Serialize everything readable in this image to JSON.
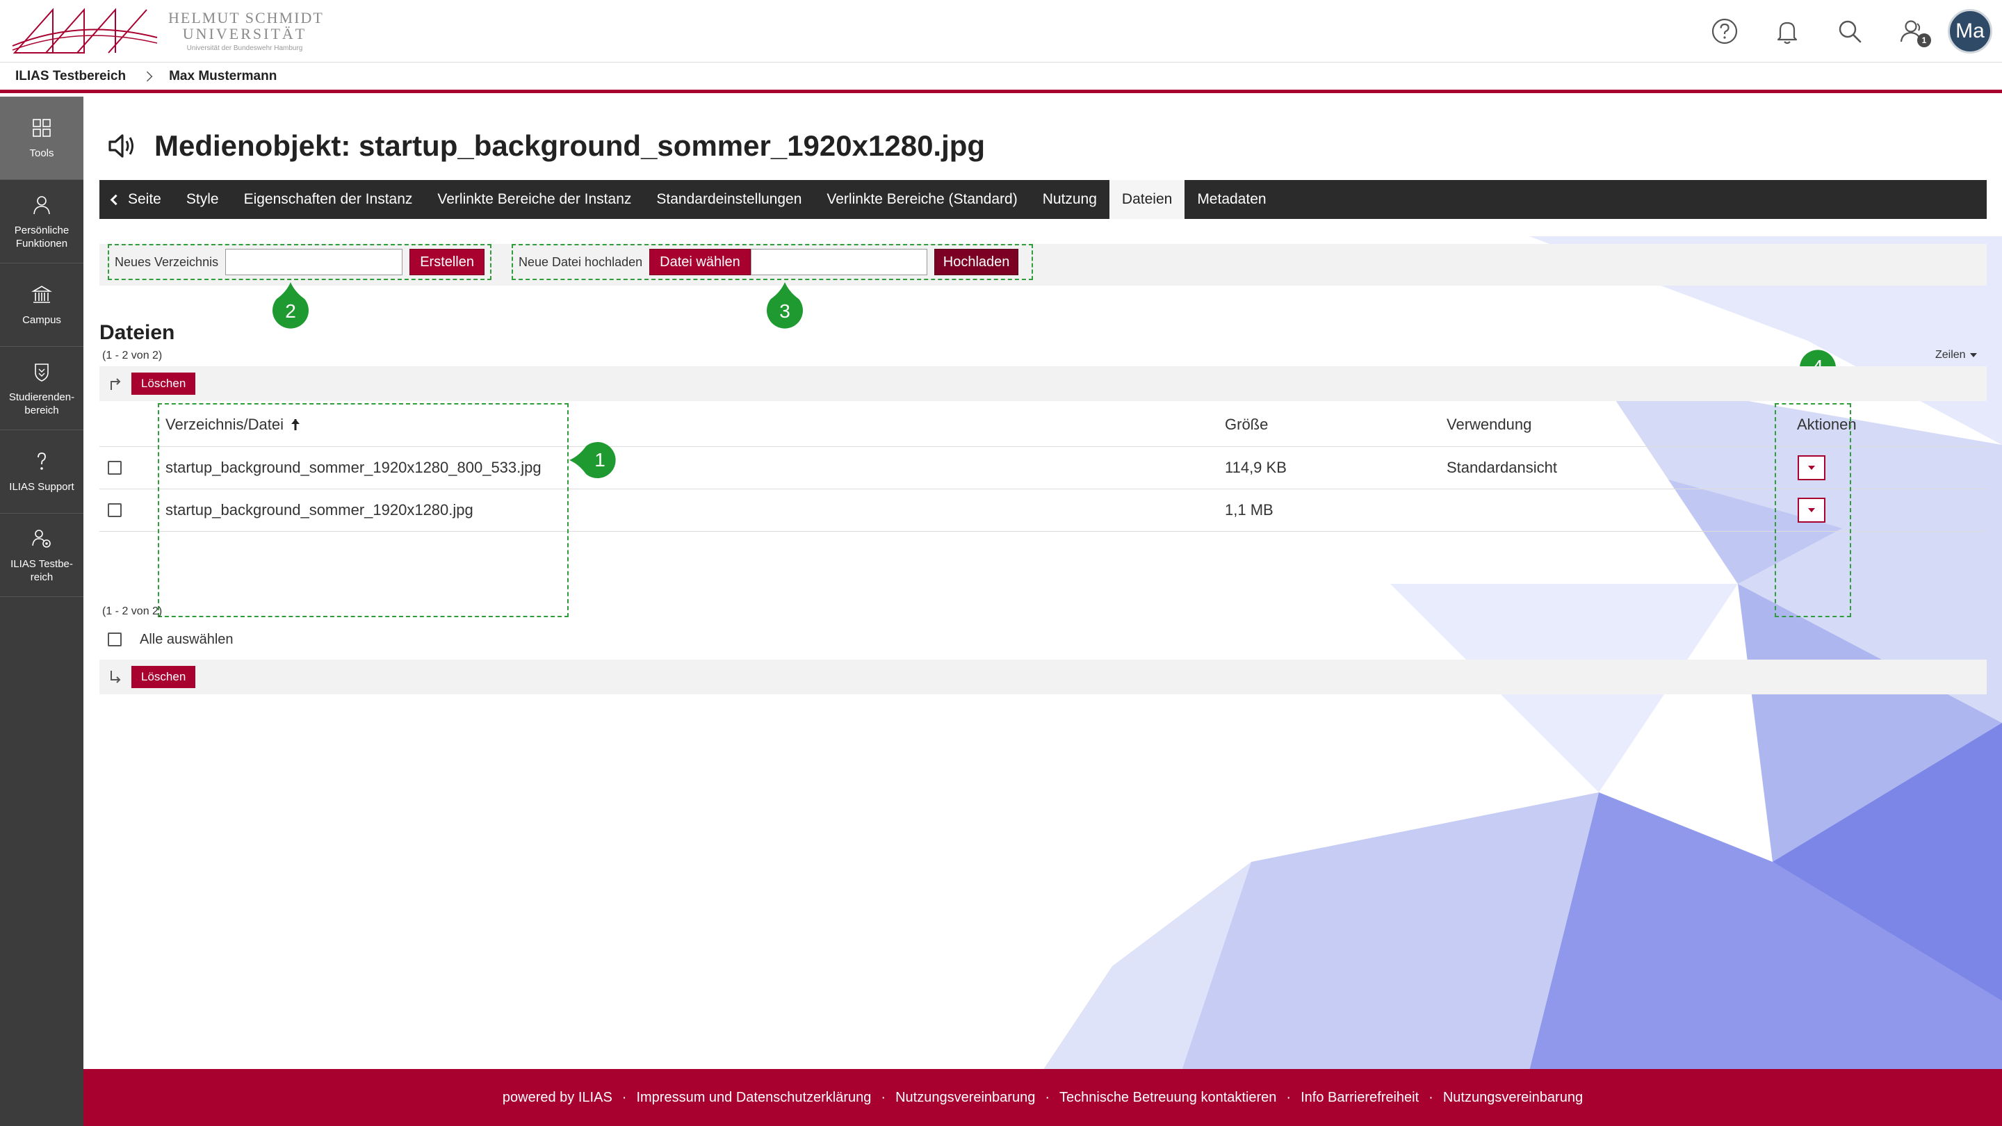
{
  "header": {
    "logo": {
      "line1": "HELMUT SCHMIDT",
      "line2": "UNIVERSITÄT",
      "line3": "Universität der Bundeswehr Hamburg"
    },
    "meta_icons": [
      "help-icon",
      "notification-icon",
      "search-icon",
      "user-notification-icon"
    ],
    "user_badge_count": "1",
    "avatar_initials": "Ma"
  },
  "breadcrumb": [
    "ILIAS Testbereich",
    "Max Mustermann"
  ],
  "mainbar": [
    {
      "label": "Tools",
      "icon": "tools-icon",
      "active": true
    },
    {
      "label": "Persönliche Funktionen",
      "icon": "user-icon"
    },
    {
      "label": "Campus",
      "icon": "campus-icon"
    },
    {
      "label": "Studierenden-bereich",
      "icon": "shield-icon"
    },
    {
      "label": "ILIAS Support",
      "icon": "question-icon"
    },
    {
      "label": "ILIAS Testbe-reich",
      "icon": "repository-icon"
    }
  ],
  "page": {
    "title": "Medienobjekt: startup_background_sommer_1920x1280.jpg",
    "title_icon": "speaker-icon"
  },
  "tabs": [
    {
      "label": "Seite",
      "back": true
    },
    {
      "label": "Style"
    },
    {
      "label": "Eigenschaften der Instanz"
    },
    {
      "label": "Verlinkte Bereiche der Instanz"
    },
    {
      "label": "Standardeinstellungen"
    },
    {
      "label": "Verlinkte Bereiche (Standard)"
    },
    {
      "label": "Nutzung"
    },
    {
      "label": "Dateien",
      "active": true
    },
    {
      "label": "Metadaten"
    }
  ],
  "toolbar": {
    "new_dir_label": "Neues Verzeichnis",
    "new_dir_value": "",
    "create_button": "Erstellen",
    "upload_label": "Neue Datei hochladen",
    "choose_file_button": "Datei wählen",
    "upload_button": "Hochladen"
  },
  "files": {
    "title": "Dateien",
    "count_top": "(1 - 2 von 2)",
    "count_bottom": "(1 - 2 von 2)",
    "rows_label": "Zeilen",
    "delete_button": "Löschen",
    "select_all_label": "Alle auswählen",
    "columns": {
      "name": "Verzeichnis/Datei",
      "size": "Größe",
      "usage": "Verwendung",
      "actions": "Aktionen"
    },
    "rows": [
      {
        "name": "startup_background_sommer_1920x1280_800_533.jpg",
        "size": "114,9 KB",
        "usage": "Standardansicht"
      },
      {
        "name": "startup_background_sommer_1920x1280.jpg",
        "size": "1,1 MB",
        "usage": ""
      }
    ]
  },
  "annotations": [
    "1",
    "2",
    "3",
    "4"
  ],
  "footer": {
    "links": [
      "powered by ILIAS",
      "Impressum und Datenschutzerklärung",
      "Nutzungsvereinbarung",
      "Technische Betreuung kontaktieren",
      "Info Barrierefreiheit",
      "Nutzungsvereinbarung"
    ]
  },
  "colors": {
    "brand": "#a8002f",
    "annotation": "#2f9e3a",
    "dark_bar": "#2b2b2b",
    "mainbar": "#3c3c3c"
  }
}
